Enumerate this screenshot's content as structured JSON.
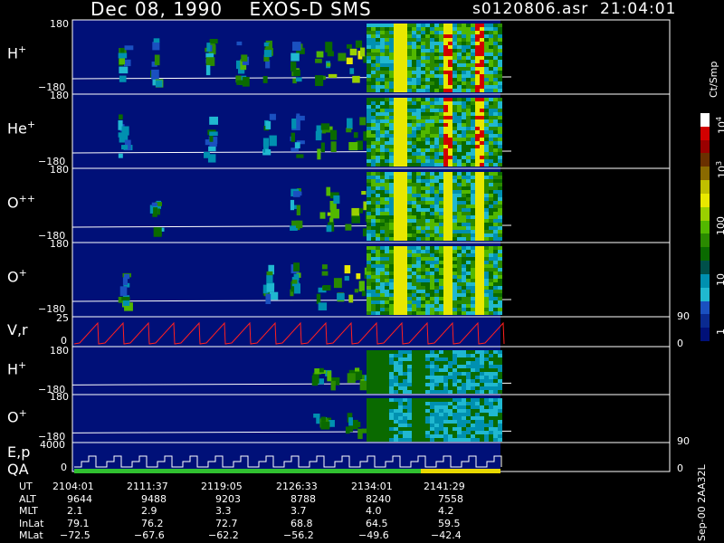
{
  "header": {
    "title": "Dec 08, 1990    EXOS-D SMS",
    "file_time": "s0120806.asr  21:04:01"
  },
  "colorbar": {
    "unit": "Ct/Smp",
    "tick_labels": [
      "10^4",
      "10^3",
      "100",
      "10",
      "1"
    ],
    "colors": [
      "#ffffff",
      "#d10000",
      "#9a0000",
      "#6a3000",
      "#8a6a00",
      "#bfbf00",
      "#e8e800",
      "#9ad000",
      "#52b800",
      "#2a8a00",
      "#0a6a00",
      "#00504a",
      "#0090b0",
      "#20b8d0",
      "#1a50c0",
      "#0a2a90",
      "#001078"
    ]
  },
  "panels": [
    {
      "species": "H+",
      "sup": "+",
      "base": "H",
      "y_top": "180",
      "y_bot": "−180"
    },
    {
      "species": "He+",
      "sup": "+",
      "base": "He",
      "y_top": "180",
      "y_bot": "−180"
    },
    {
      "species": "O++",
      "sup": "++",
      "base": "O",
      "y_top": "180",
      "y_bot": "−180"
    },
    {
      "species": "O+",
      "sup": "+",
      "base": "O",
      "y_top": "180",
      "y_bot": "−180"
    },
    {
      "species": "V,r",
      "y_top": "25",
      "y_bot": "0",
      "right_top": "90",
      "right_bot": "0"
    },
    {
      "species": "H+",
      "sup": "+",
      "base": "H",
      "y_top": "180",
      "y_bot": "−180"
    },
    {
      "species": "O+",
      "sup": "+",
      "base": "O",
      "y_top": "180",
      "y_bot": "−180",
      "right_bot": "90"
    },
    {
      "species": "E,p",
      "label2": "QA",
      "y_top": "4000",
      "y_bot": "0",
      "right_bot": "0"
    }
  ],
  "orbit_table": {
    "rows": [
      {
        "name": "UT",
        "values": [
          "2104:01",
          "2111:37",
          "2119:05",
          "2126:33",
          "2134:01",
          "2141:29"
        ]
      },
      {
        "name": "ALT",
        "values": [
          "9644",
          "9488",
          "9203",
          "8788",
          "8240",
          "7558"
        ]
      },
      {
        "name": "MLT",
        "values": [
          "2.1",
          "2.9",
          "3.3",
          "3.7",
          "4.0",
          "4.2"
        ]
      },
      {
        "name": "InLat",
        "values": [
          "79.1",
          "76.2",
          "72.7",
          "68.8",
          "64.5",
          "59.5"
        ]
      },
      {
        "name": "MLat",
        "values": [
          "−72.5",
          "−67.6",
          "−62.2",
          "−56.2",
          "−49.6",
          "−42.4"
        ]
      }
    ]
  },
  "footer_note": "Sep-00  2AA32L",
  "chart_data": {
    "type": "heatmap",
    "title": "Dec 08, 1990    EXOS-D SMS",
    "x": [
      "2104:01",
      "2111:37",
      "2119:05",
      "2126:33",
      "2134:01",
      "2141:29"
    ],
    "ylabel_panels": [
      "H+",
      "He+",
      "O++",
      "O+",
      "V,r",
      "H+",
      "O+",
      "E,p QA"
    ],
    "ylim_angle": [
      -180,
      180
    ],
    "colorbar_range": [
      1,
      10000
    ],
    "colorbar_scale": "log",
    "grid": false
  }
}
